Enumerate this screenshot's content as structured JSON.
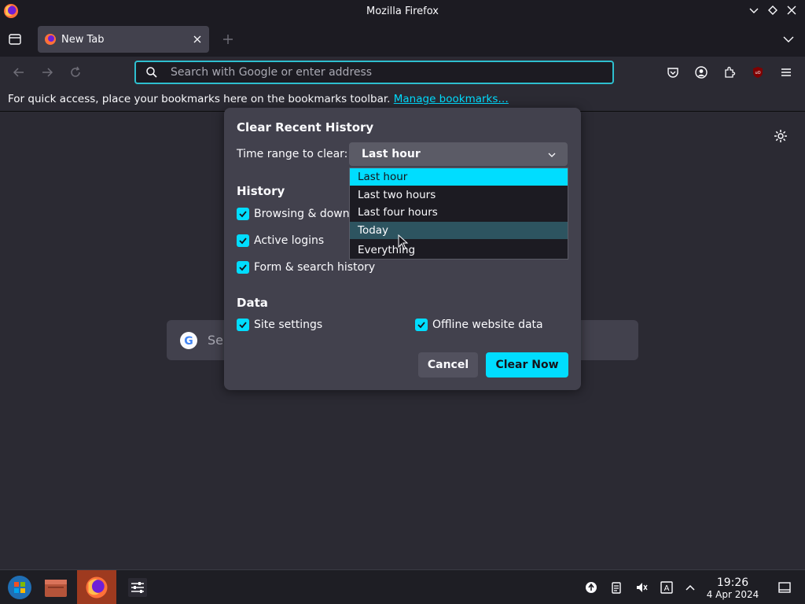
{
  "window": {
    "title": "Mozilla Firefox"
  },
  "tabs": [
    {
      "label": "New Tab"
    }
  ],
  "urlbar": {
    "placeholder": "Search with Google or enter address"
  },
  "bookmarks_toolbar": {
    "message": "For quick access, place your bookmarks here on the bookmarks toolbar.",
    "link": "Manage bookmarks…"
  },
  "page": {
    "search_partial": "Se"
  },
  "dialog": {
    "title": "Clear Recent History",
    "range_label": "Time range to clear:",
    "range_value": "Last hour",
    "history_heading": "History",
    "history_items": [
      "Browsing & downlo",
      "Active logins",
      "Form & search history"
    ],
    "data_heading": "Data",
    "data_items": [
      "Site settings",
      "Offline website data"
    ],
    "cancel": "Cancel",
    "clear_now": "Clear Now"
  },
  "dropdown": {
    "options": [
      "Last hour",
      "Last two hours",
      "Last four hours",
      "Today",
      "Everything"
    ]
  },
  "taskbar": {
    "time": "19:26",
    "date": "4 Apr 2024"
  },
  "colors": {
    "accent": "#00ddff",
    "bg": "#2b2a33",
    "dialog": "#42414d",
    "taskbar_active": "#9e3a1f"
  }
}
